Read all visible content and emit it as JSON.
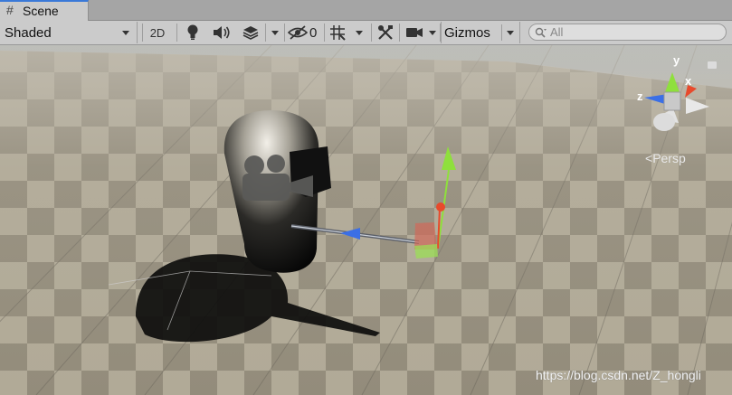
{
  "tab": {
    "label": "Scene"
  },
  "toolbar": {
    "shading_mode": "Shaded",
    "mode_2d": "2D",
    "hidden_count": "0",
    "gizmos_label": "Gizmos",
    "search_placeholder": "All"
  },
  "gizmo": {
    "x_label": "x",
    "y_label": "y",
    "z_label": "z",
    "projection": "Persp"
  },
  "watermark": "https://blog.csdn.net/Z_hongli",
  "icons": [
    "grid-hash-icon",
    "lightbulb-icon",
    "audio-icon",
    "effects-icon",
    "visibility-icon",
    "grid-snap-icon",
    "tools-icon",
    "camera-icon",
    "search-icon",
    "lock-icon"
  ]
}
